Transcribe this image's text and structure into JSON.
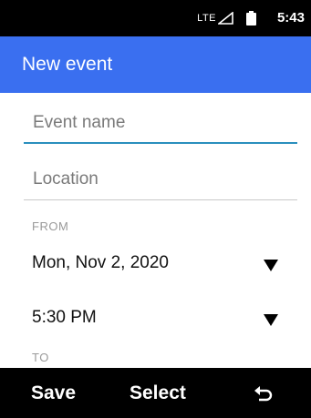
{
  "status_bar": {
    "network": "LTE",
    "time": "5:43",
    "icons": [
      "signal-icon",
      "battery-icon"
    ]
  },
  "app_bar": {
    "title": "New event"
  },
  "form": {
    "event_name": {
      "value": "",
      "placeholder": "Event name"
    },
    "location": {
      "value": "",
      "placeholder": "Location"
    },
    "from_label": "FROM",
    "from_date": "Mon, Nov 2, 2020",
    "from_time": "5:30 PM",
    "to_label": "TO"
  },
  "softkeys": {
    "left": "Save",
    "center": "Select",
    "right_icon": "back-icon"
  },
  "colors": {
    "app_bar": "#3a6ff0",
    "focus_underline": "#2a8fbd",
    "status_bar": "#000000"
  }
}
